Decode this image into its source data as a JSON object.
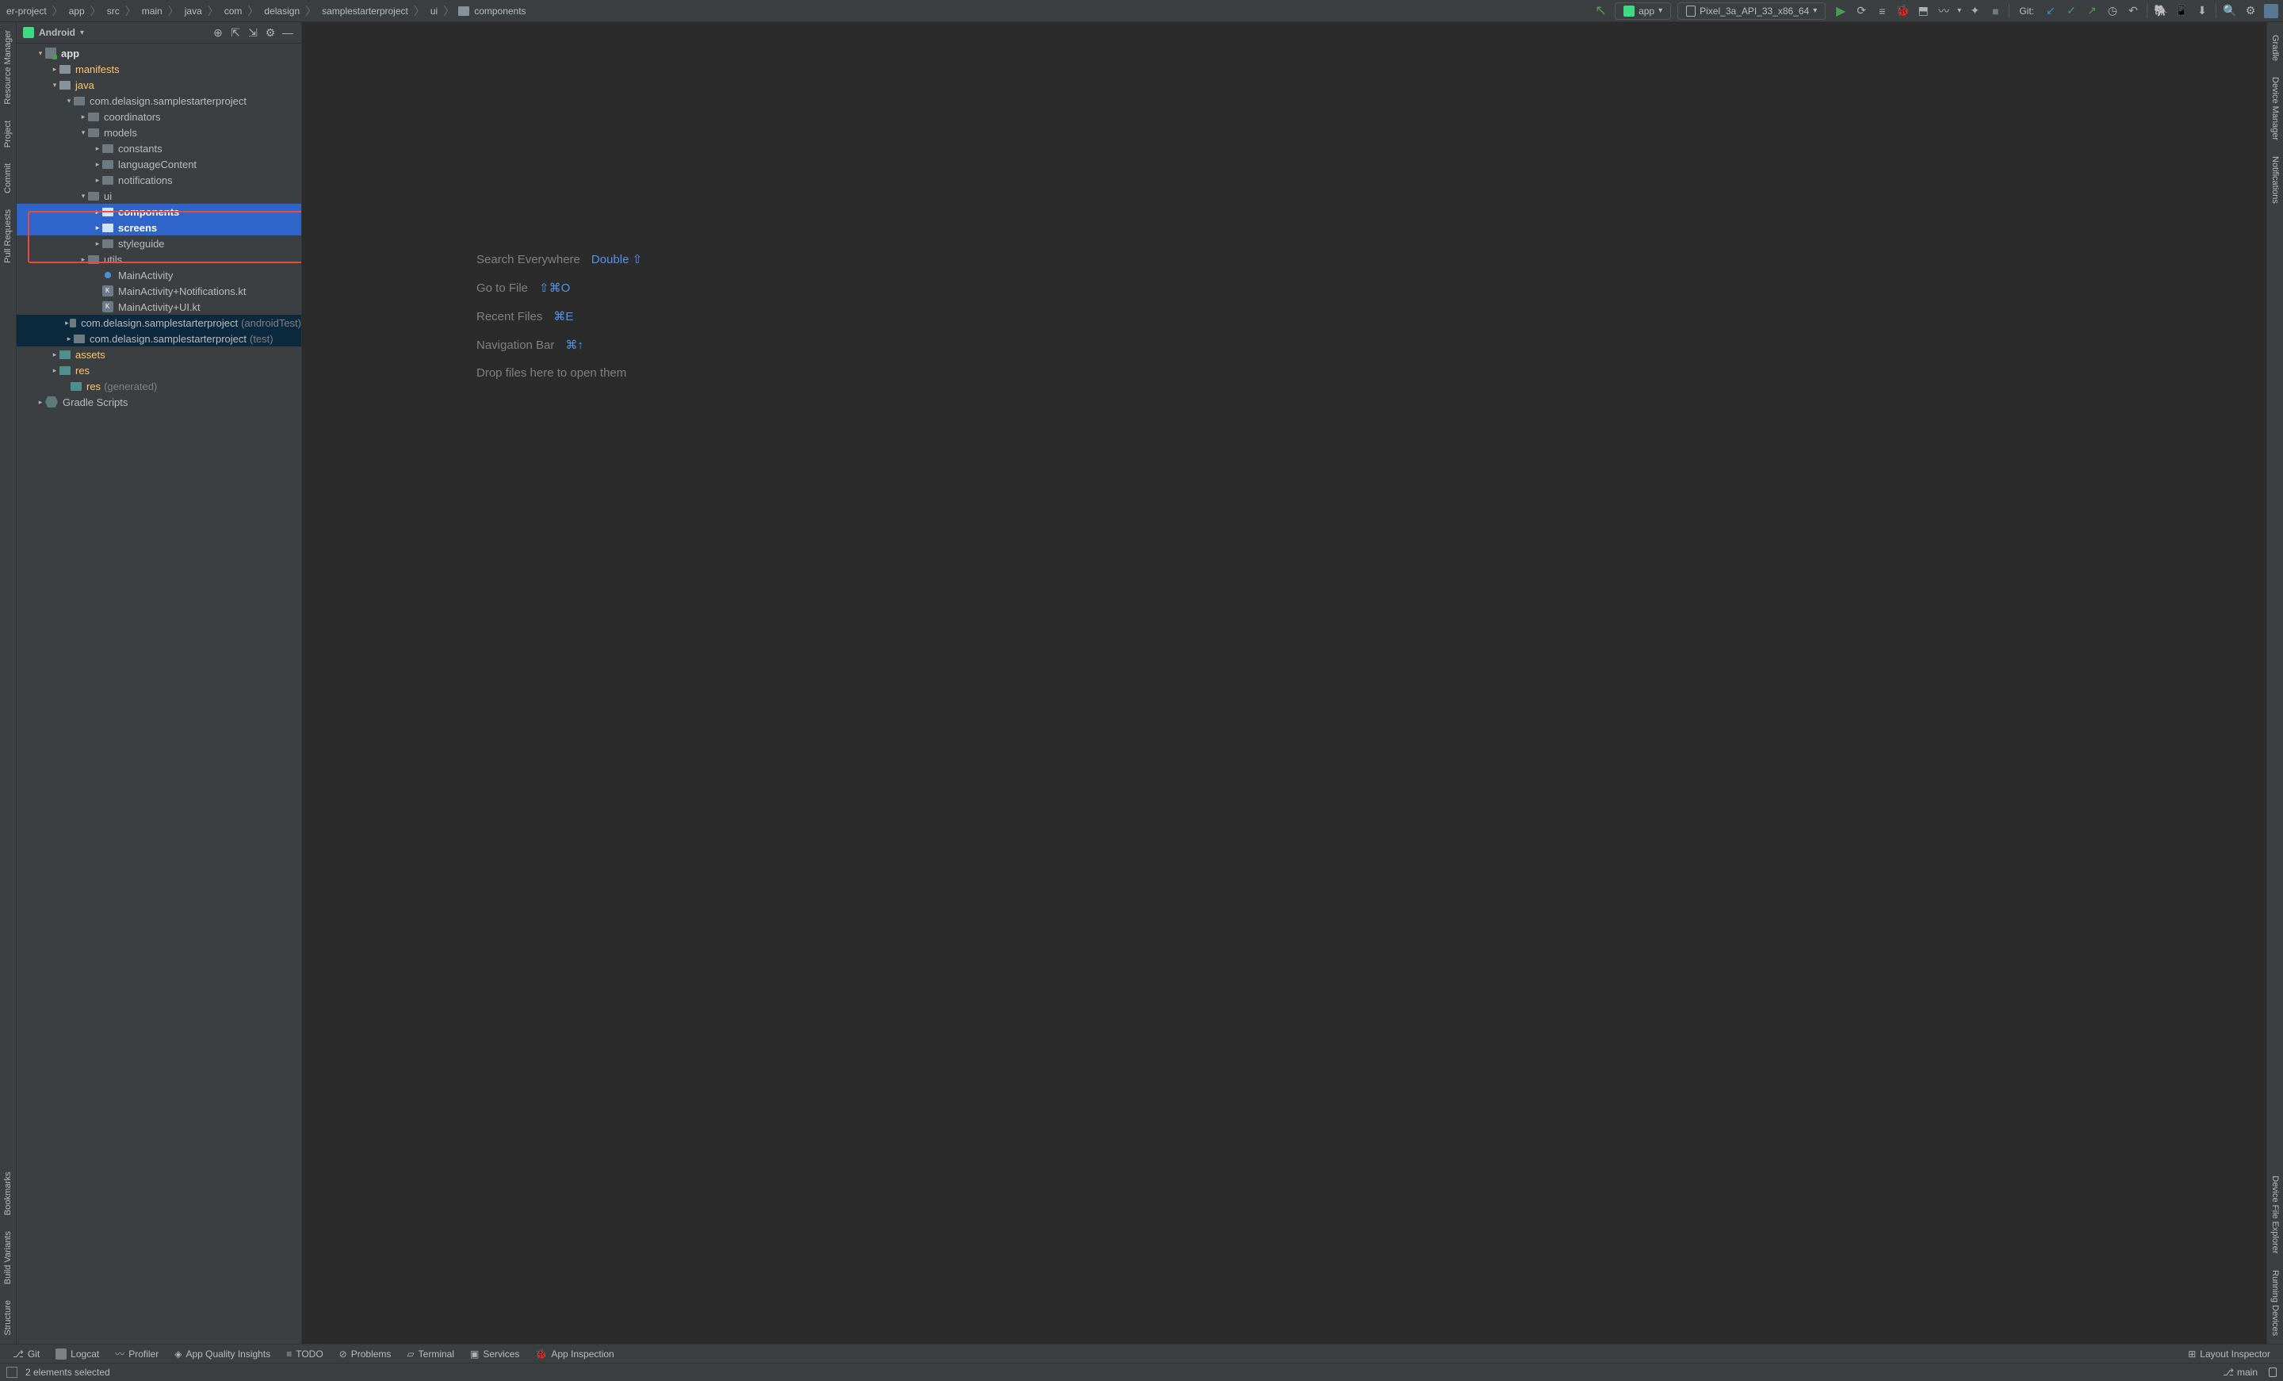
{
  "breadcrumb": [
    "er-project",
    "app",
    "src",
    "main",
    "java",
    "com",
    "delasign",
    "samplestarterproject",
    "ui",
    "components"
  ],
  "runConfig": {
    "appLabel": "app",
    "deviceLabel": "Pixel_3a_API_33_x86_64"
  },
  "gitLabel": "Git:",
  "projectPanel": {
    "viewName": "Android"
  },
  "tree": {
    "app": "app",
    "manifests": "manifests",
    "java": "java",
    "pkg1": "com.delasign.samplestarterproject",
    "coordinators": "coordinators",
    "models": "models",
    "constants": "constants",
    "languageContent": "languageContent",
    "notifications": "notifications",
    "ui": "ui",
    "components": "components",
    "screens": "screens",
    "styleguide": "styleguide",
    "utils": "utils",
    "mainActivity": "MainActivity",
    "mainNotif": "MainActivity+Notifications.kt",
    "mainUI": "MainActivity+UI.kt",
    "pkgAndroidTest": "com.delasign.samplestarterproject",
    "pkgAndroidTestSuffix": "(androidTest)",
    "pkgTest": "com.delasign.samplestarterproject",
    "pkgTestSuffix": "(test)",
    "assets": "assets",
    "res": "res",
    "resGen": "res",
    "resGenSuffix": "(generated)",
    "gradle": "Gradle Scripts"
  },
  "emptyEditor": {
    "searchEverywhere": "Search Everywhere",
    "searchShortcut": "Double ⇧",
    "goToFile": "Go to File",
    "goToFileShortcut": "⇧⌘O",
    "recentFiles": "Recent Files",
    "recentFilesShortcut": "⌘E",
    "navBar": "Navigation Bar",
    "navBarShortcut": "⌘↑",
    "dropFiles": "Drop files here to open them"
  },
  "leftTabs": {
    "resourceManager": "Resource Manager",
    "project": "Project",
    "commit": "Commit",
    "pullRequests": "Pull Requests",
    "bookmarks": "Bookmarks",
    "buildVariants": "Build Variants",
    "structure": "Structure"
  },
  "rightTabs": {
    "gradle": "Gradle",
    "deviceManager": "Device Manager",
    "notifications": "Notifications",
    "deviceFileExplorer": "Device File Explorer",
    "runningDevices": "Running Devices"
  },
  "bottomTabs": {
    "git": "Git",
    "logcat": "Logcat",
    "profiler": "Profiler",
    "appQuality": "App Quality Insights",
    "todo": "TODO",
    "problems": "Problems",
    "terminal": "Terminal",
    "services": "Services",
    "appInspection": "App Inspection",
    "layoutInspector": "Layout Inspector"
  },
  "statusBar": {
    "selected": "2 elements selected",
    "branch": "main"
  }
}
